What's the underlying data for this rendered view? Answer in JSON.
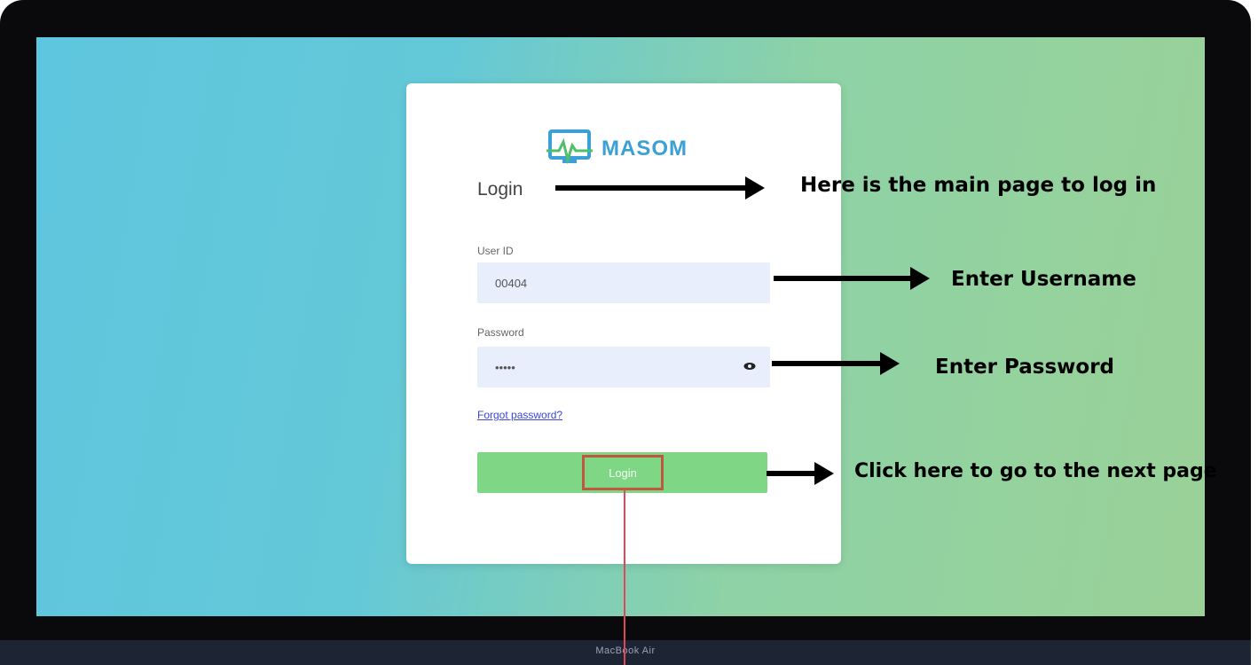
{
  "app": {
    "brand_name": "MASOM",
    "base_label": "MacBook Air"
  },
  "login_form": {
    "heading": "Login",
    "username_label": "User ID",
    "username_value": "00404",
    "password_label": "Password",
    "password_value": "•••••",
    "forgot_password_label": "Forgot password?",
    "login_button_label": "Login"
  },
  "annotations": {
    "main_page_note": "Here is the main page to log in",
    "username_note": "Enter Username",
    "password_note": "Enter Password",
    "next_page_note": "Click here to go to the next page"
  },
  "icons": {
    "logo": "monitor-heartbeat-icon",
    "password_toggle": "eye-icon"
  },
  "colors": {
    "background_start": "#5ec6de",
    "background_end": "#9ad197",
    "card": "#ffffff",
    "input_fill": "#e8eefc",
    "login_button": "#7fd685",
    "brand": "#3aa0d6",
    "highlight_box": "#c0573e",
    "link": "#3a45d6"
  }
}
